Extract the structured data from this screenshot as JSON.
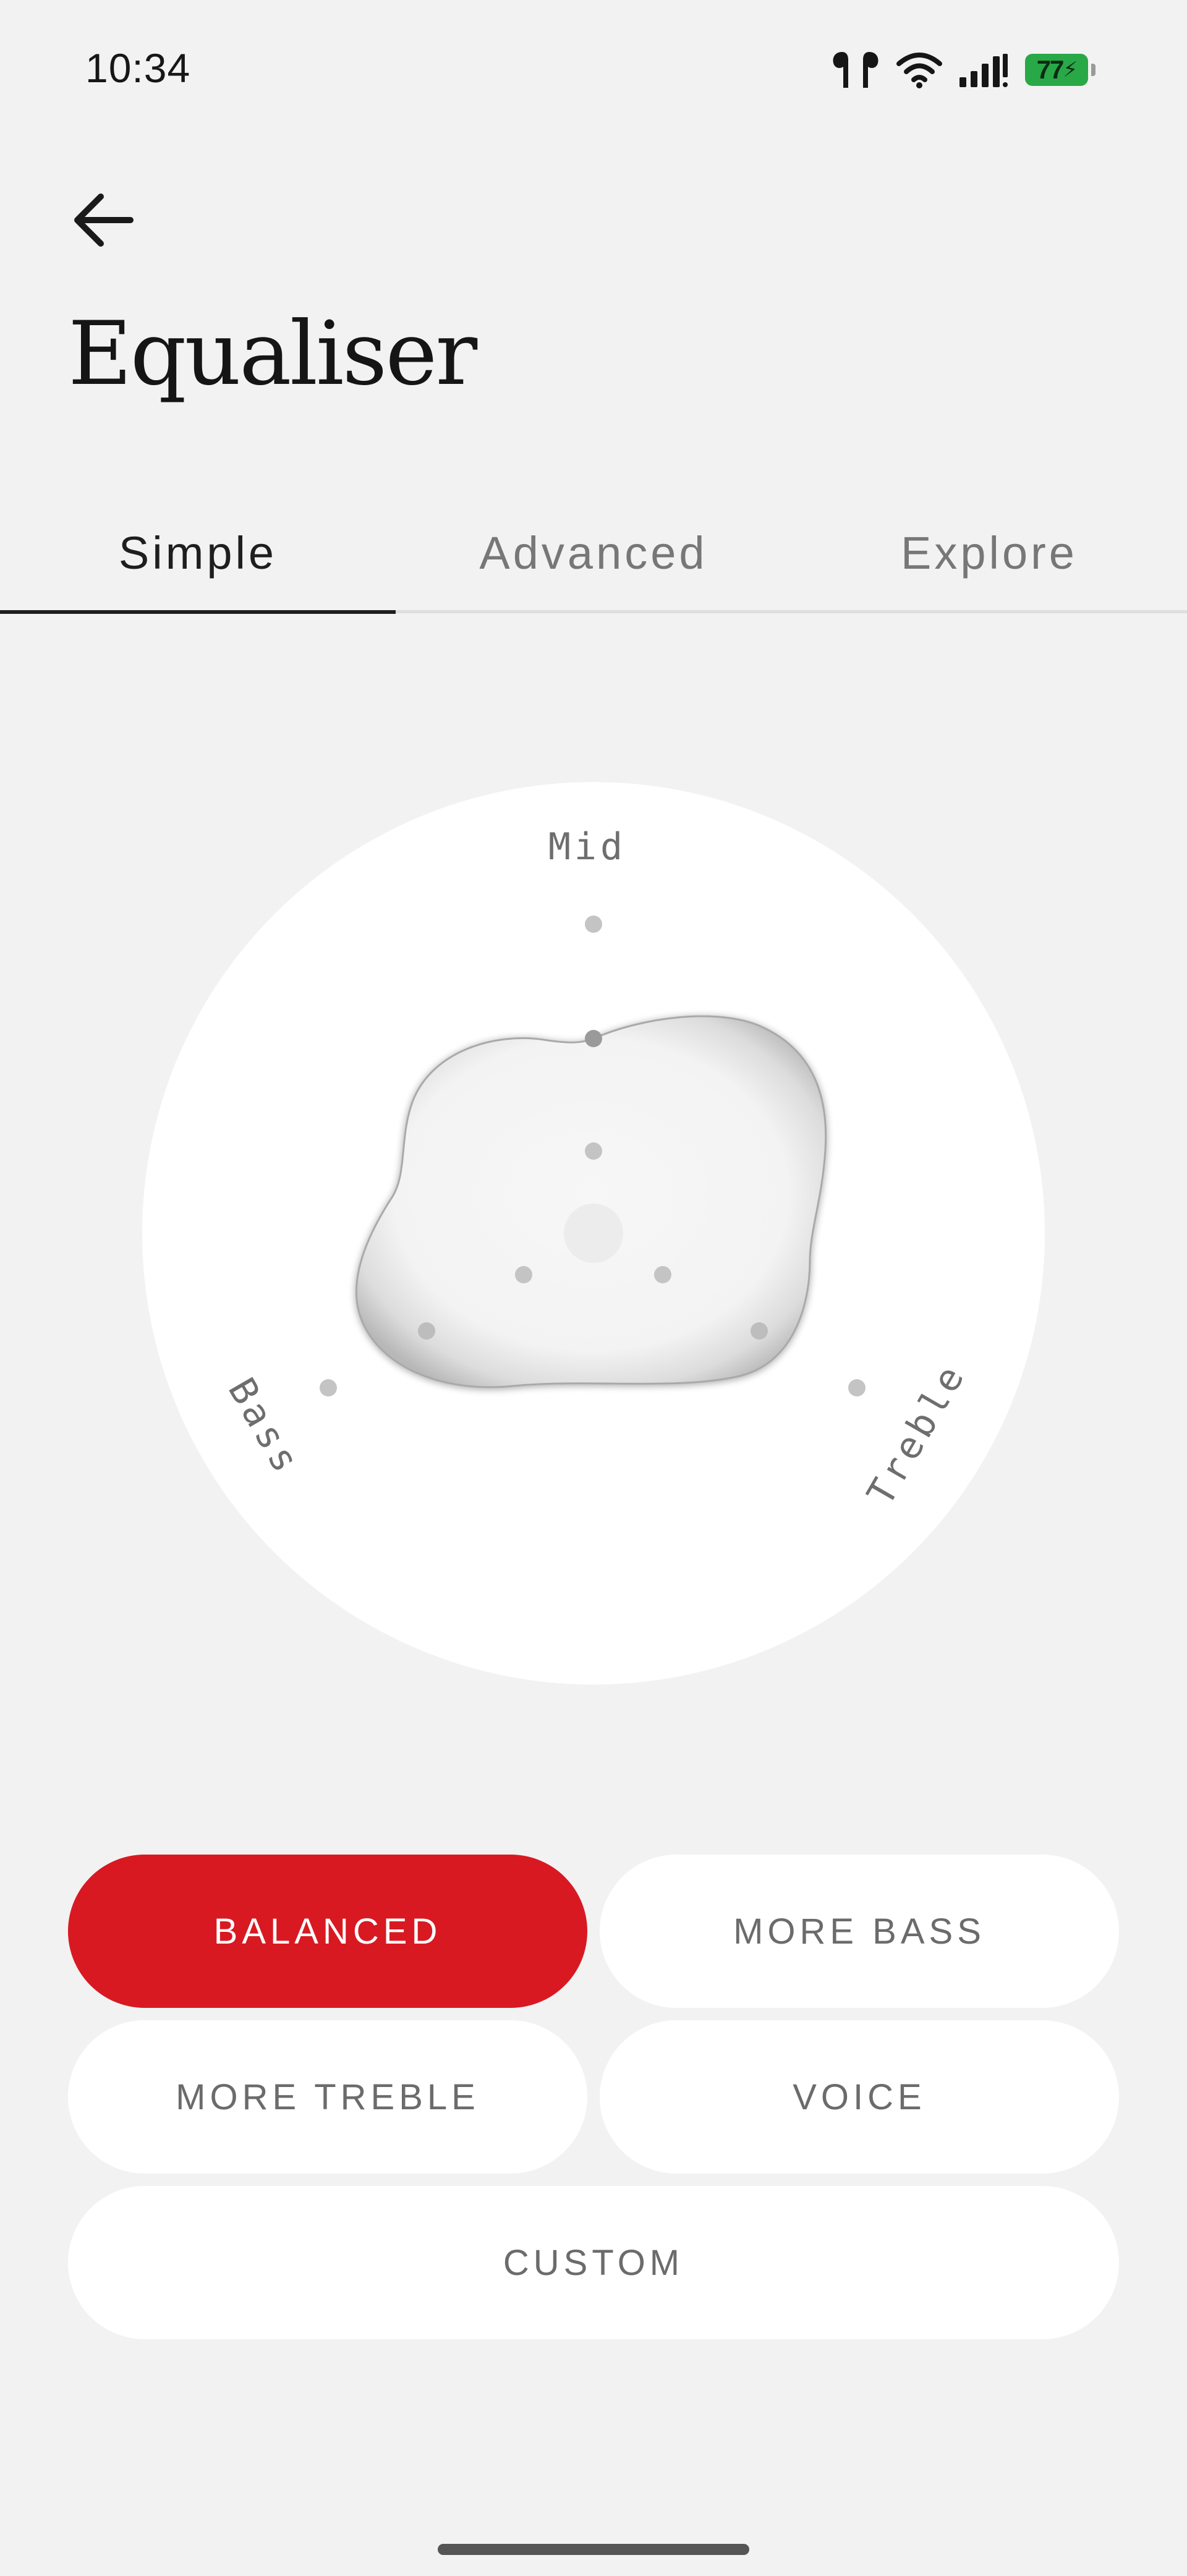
{
  "status_bar": {
    "time": "10:34",
    "battery_level": "77",
    "icons": [
      "earbuds-icon",
      "wifi-icon",
      "signal-icon",
      "battery-icon"
    ]
  },
  "header": {
    "back_icon": "arrow-left-icon",
    "title": "Equaliser"
  },
  "tabs": [
    {
      "label": "Simple",
      "active": true
    },
    {
      "label": "Advanced",
      "active": false
    },
    {
      "label": "Explore",
      "active": false
    }
  ],
  "equalizer": {
    "axes": {
      "mid": "Mid",
      "bass": "Bass",
      "treble": "Treble"
    }
  },
  "presets": [
    {
      "label": "BALANCED",
      "active": true
    },
    {
      "label": "MORE BASS",
      "active": false
    },
    {
      "label": "MORE TREBLE",
      "active": false
    },
    {
      "label": "VOICE",
      "active": false
    },
    {
      "label": "CUSTOM",
      "active": false
    }
  ],
  "colors": {
    "accent": "#d81921",
    "background": "#f2f2f2",
    "surface": "#ffffff"
  }
}
